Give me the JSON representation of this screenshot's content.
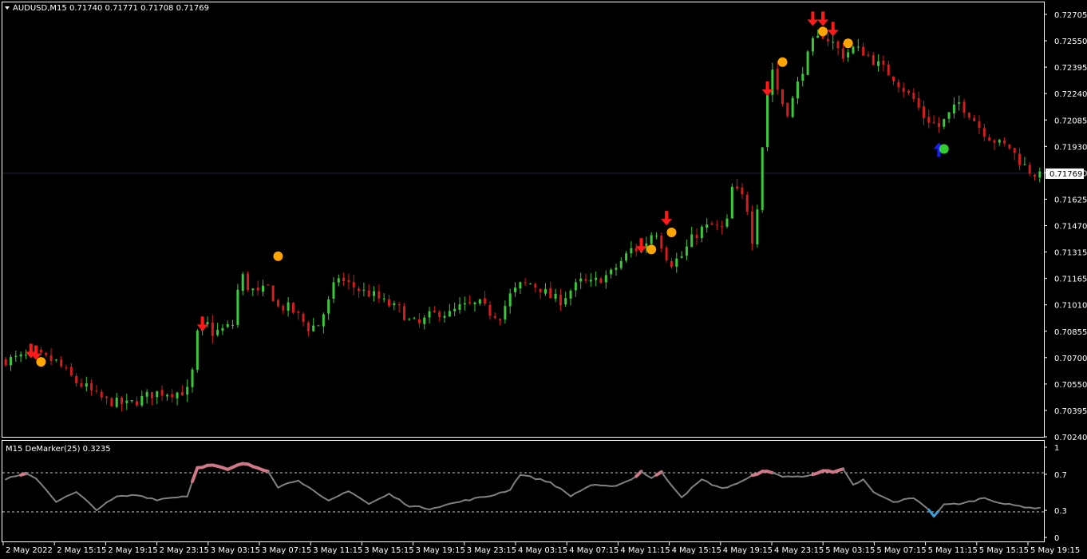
{
  "header": {
    "symbol": "AUDUSD,M15",
    "ohlc": "0.71740 0.71771 0.71708 0.71769"
  },
  "indicator": {
    "label": "M15 DeMarker(25) 0.3235",
    "levels": [
      "1",
      "0.7",
      "0.3",
      "0"
    ]
  },
  "colors": {
    "background": "#000000",
    "frame": "#ffffff",
    "bull": "#3cc83c",
    "bear": "#d21e1e",
    "arrow_down": "#ff1a1a",
    "arrow_up": "#1a1aff",
    "dot_orange": "#ffa500",
    "dot_green": "#32cd32",
    "demarker": "#808080",
    "demarker_high": "#d07888",
    "demarker_low": "#3aa0dc"
  },
  "chart_data": {
    "type": "candlestick",
    "symbol": "AUDUSD",
    "timeframe": "M15",
    "price_axis": {
      "ticks": [
        "0.72705",
        "0.72550",
        "0.72395",
        "0.72240",
        "0.72085",
        "0.71930",
        "0.71780",
        "0.71625",
        "0.71470",
        "0.71315",
        "0.71165",
        "0.71010",
        "0.70855",
        "0.70700",
        "0.70550",
        "0.70395",
        "0.70240"
      ],
      "current_price": "0.71769",
      "ylim": [
        0.7024,
        0.7272
      ]
    },
    "time_axis": {
      "ticks": [
        "2 May 2022",
        "2 May 15:15",
        "2 May 19:15",
        "2 May 23:15",
        "3 May 03:15",
        "3 May 07:15",
        "3 May 11:15",
        "3 May 15:15",
        "3 May 19:15",
        "3 May 23:15",
        "4 May 03:15",
        "4 May 07:15",
        "4 May 11:15",
        "4 May 15:15",
        "4 May 19:15",
        "4 May 23:15",
        "5 May 03:15",
        "5 May 07:15",
        "5 May 11:15",
        "5 May 15:15",
        "5 May 19:15"
      ]
    },
    "close_path": [
      [
        0,
        0.7069
      ],
      [
        6,
        0.7072
      ],
      [
        10,
        0.7068
      ],
      [
        12,
        0.7062
      ],
      [
        14,
        0.7056
      ],
      [
        16,
        0.7053
      ],
      [
        18,
        0.7048
      ],
      [
        20,
        0.7045
      ],
      [
        22,
        0.7044
      ],
      [
        24,
        0.7043
      ],
      [
        26,
        0.7045
      ],
      [
        28,
        0.7048
      ],
      [
        30,
        0.705
      ],
      [
        32,
        0.705
      ],
      [
        34,
        0.705
      ],
      [
        36,
        0.7051
      ],
      [
        37,
        0.7062
      ],
      [
        38,
        0.7084
      ],
      [
        39,
        0.7088
      ],
      [
        40,
        0.709
      ],
      [
        41,
        0.7085
      ],
      [
        43,
        0.7087
      ],
      [
        45,
        0.709
      ],
      [
        46,
        0.711
      ],
      [
        47,
        0.7118
      ],
      [
        48,
        0.7112
      ],
      [
        50,
        0.7108
      ],
      [
        52,
        0.7112
      ],
      [
        54,
        0.71
      ],
      [
        56,
        0.71
      ],
      [
        58,
        0.7095
      ],
      [
        60,
        0.7088
      ],
      [
        62,
        0.709
      ],
      [
        64,
        0.7103
      ],
      [
        65,
        0.7112
      ],
      [
        66,
        0.7118
      ],
      [
        67,
        0.7115
      ],
      [
        69,
        0.7112
      ],
      [
        71,
        0.7109
      ],
      [
        73,
        0.7107
      ],
      [
        75,
        0.7103
      ],
      [
        77,
        0.71
      ],
      [
        78,
        0.7099
      ],
      [
        80,
        0.7092
      ],
      [
        82,
        0.709
      ],
      [
        84,
        0.7095
      ],
      [
        86,
        0.7097
      ],
      [
        88,
        0.7096
      ],
      [
        90,
        0.71
      ],
      [
        92,
        0.7101
      ],
      [
        94,
        0.7102
      ],
      [
        96,
        0.7097
      ],
      [
        98,
        0.7095
      ],
      [
        100,
        0.7107
      ],
      [
        102,
        0.7113
      ],
      [
        104,
        0.7114
      ],
      [
        106,
        0.7111
      ],
      [
        108,
        0.7106
      ],
      [
        110,
        0.7104
      ],
      [
        112,
        0.711
      ],
      [
        114,
        0.7115
      ],
      [
        116,
        0.7114
      ],
      [
        118,
        0.7117
      ],
      [
        120,
        0.712
      ],
      [
        122,
        0.7127
      ],
      [
        124,
        0.7134
      ],
      [
        126,
        0.7134
      ],
      [
        128,
        0.7143
      ],
      [
        129,
        0.7144
      ],
      [
        130,
        0.7137
      ],
      [
        131,
        0.713
      ],
      [
        132,
        0.7126
      ],
      [
        134,
        0.713
      ],
      [
        136,
        0.714
      ],
      [
        138,
        0.7146
      ],
      [
        140,
        0.7148
      ],
      [
        142,
        0.7146
      ],
      [
        143,
        0.715
      ],
      [
        144,
        0.717
      ],
      [
        146,
        0.7165
      ],
      [
        147,
        0.7158
      ],
      [
        148,
        0.714
      ],
      [
        149,
        0.716
      ],
      [
        150,
        0.7195
      ],
      [
        151,
        0.7225
      ],
      [
        152,
        0.724
      ],
      [
        153,
        0.7228
      ],
      [
        154,
        0.722
      ],
      [
        155,
        0.7215
      ],
      [
        156,
        0.7222
      ],
      [
        158,
        0.724
      ],
      [
        160,
        0.7255
      ],
      [
        162,
        0.726
      ],
      [
        164,
        0.7255
      ],
      [
        166,
        0.7248
      ],
      [
        168,
        0.7252
      ],
      [
        170,
        0.725
      ],
      [
        172,
        0.7245
      ],
      [
        174,
        0.724
      ],
      [
        176,
        0.7235
      ],
      [
        178,
        0.7228
      ],
      [
        180,
        0.7222
      ],
      [
        182,
        0.7212
      ],
      [
        184,
        0.7208
      ],
      [
        185,
        0.7206
      ],
      [
        187,
        0.7213
      ],
      [
        189,
        0.722
      ],
      [
        191,
        0.7214
      ],
      [
        193,
        0.7206
      ],
      [
        195,
        0.72
      ],
      [
        197,
        0.7196
      ],
      [
        199,
        0.7194
      ],
      [
        201,
        0.7186
      ],
      [
        203,
        0.718
      ],
      [
        205,
        0.7177
      ]
    ],
    "signals": [
      {
        "type": "sell_arrow",
        "bar": 5,
        "price": 0.7073
      },
      {
        "type": "sell_arrow",
        "bar": 6,
        "price": 0.7072
      },
      {
        "type": "exit_dot",
        "bar": 7,
        "price": 0.7068
      },
      {
        "type": "sell_arrow",
        "bar": 39,
        "price": 0.7089
      },
      {
        "type": "exit_dot",
        "bar": 54,
        "price": 0.713
      },
      {
        "type": "sell_arrow",
        "bar": 126,
        "price": 0.7135
      },
      {
        "type": "exit_dot",
        "bar": 128,
        "price": 0.7134
      },
      {
        "type": "sell_arrow",
        "bar": 131,
        "price": 0.7151
      },
      {
        "type": "exit_dot",
        "bar": 132,
        "price": 0.7144
      },
      {
        "type": "sell_arrow",
        "bar": 151,
        "price": 0.7227
      },
      {
        "type": "exit_dot",
        "bar": 154,
        "price": 0.7244
      },
      {
        "type": "sell_arrow",
        "bar": 160,
        "price": 0.7268
      },
      {
        "type": "sell_arrow",
        "bar": 162,
        "price": 0.7268
      },
      {
        "type": "exit_dot",
        "bar": 162,
        "price": 0.7262
      },
      {
        "type": "sell_arrow",
        "bar": 164,
        "price": 0.7262
      },
      {
        "type": "exit_dot",
        "bar": 167,
        "price": 0.7255
      },
      {
        "type": "buy_arrow",
        "bar": 185,
        "price": 0.7193
      },
      {
        "type": "exit_dot",
        "bar": 186,
        "price": 0.7193
      }
    ],
    "demarker": {
      "period": 25,
      "current": "0.3235",
      "ylim": [
        0,
        1
      ],
      "levels": [
        0.3,
        0.7
      ],
      "path": [
        [
          0,
          0.65
        ],
        [
          4,
          0.7
        ],
        [
          6,
          0.66
        ],
        [
          10,
          0.4
        ],
        [
          14,
          0.5
        ],
        [
          18,
          0.31
        ],
        [
          22,
          0.45
        ],
        [
          26,
          0.47
        ],
        [
          30,
          0.42
        ],
        [
          34,
          0.45
        ],
        [
          36,
          0.46
        ],
        [
          38,
          0.78
        ],
        [
          41,
          0.8
        ],
        [
          44,
          0.75
        ],
        [
          47,
          0.82
        ],
        [
          52,
          0.74
        ],
        [
          54,
          0.56
        ],
        [
          58,
          0.64
        ],
        [
          62,
          0.47
        ],
        [
          64,
          0.4
        ],
        [
          68,
          0.52
        ],
        [
          72,
          0.37
        ],
        [
          76,
          0.48
        ],
        [
          80,
          0.35
        ],
        [
          84,
          0.32
        ],
        [
          88,
          0.37
        ],
        [
          92,
          0.42
        ],
        [
          96,
          0.46
        ],
        [
          100,
          0.53
        ],
        [
          102,
          0.7
        ],
        [
          106,
          0.64
        ],
        [
          108,
          0.61
        ],
        [
          112,
          0.46
        ],
        [
          116,
          0.58
        ],
        [
          120,
          0.56
        ],
        [
          124,
          0.64
        ],
        [
          126,
          0.73
        ],
        [
          128,
          0.66
        ],
        [
          130,
          0.72
        ],
        [
          131,
          0.65
        ],
        [
          134,
          0.45
        ],
        [
          138,
          0.64
        ],
        [
          142,
          0.54
        ],
        [
          146,
          0.62
        ],
        [
          150,
          0.74
        ],
        [
          154,
          0.68
        ],
        [
          158,
          0.67
        ],
        [
          162,
          0.74
        ],
        [
          164,
          0.72
        ],
        [
          166,
          0.75
        ],
        [
          168,
          0.58
        ],
        [
          170,
          0.64
        ],
        [
          172,
          0.5
        ],
        [
          176,
          0.39
        ],
        [
          180,
          0.44
        ],
        [
          182,
          0.36
        ],
        [
          184,
          0.24
        ],
        [
          186,
          0.36
        ],
        [
          190,
          0.38
        ],
        [
          194,
          0.44
        ],
        [
          198,
          0.37
        ],
        [
          202,
          0.34
        ],
        [
          205,
          0.32
        ]
      ]
    }
  }
}
